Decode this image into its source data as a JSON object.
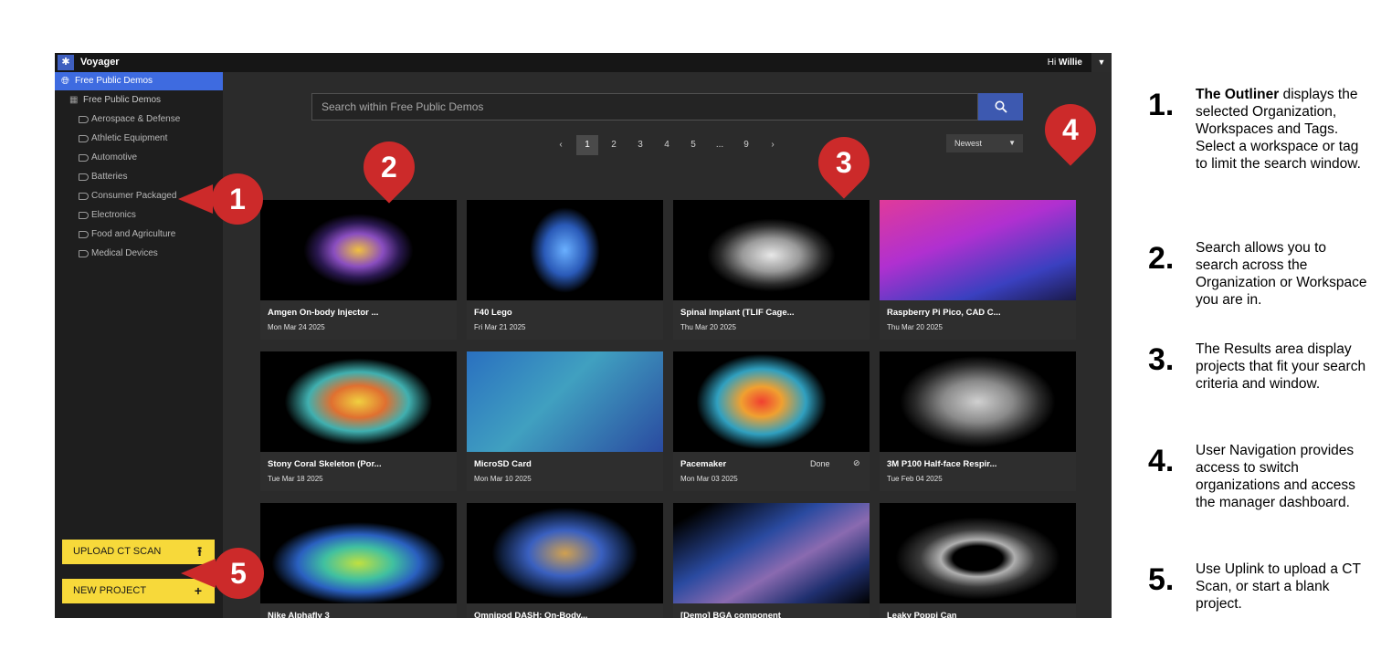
{
  "app": {
    "logo_glyph": "✱",
    "title": "Voyager",
    "greeting_prefix": "Hi",
    "user_name": "Willie"
  },
  "sidebar": {
    "organization": "Free Public Demos",
    "workspace": "Free Public Demos",
    "tags": [
      "Aerospace & Defense",
      "Athletic Equipment",
      "Automotive",
      "Batteries",
      "Consumer Packaged",
      "Electronics",
      "Food and Agriculture",
      "Medical Devices"
    ],
    "upload_label": "UPLOAD CT SCAN",
    "new_project_label": "NEW PROJECT"
  },
  "search": {
    "placeholder": "Search within Free Public Demos"
  },
  "pagination": {
    "prev": "‹",
    "pages": [
      "1",
      "2",
      "3",
      "4",
      "5",
      "...",
      "9"
    ],
    "next": "›",
    "current": "1"
  },
  "sort": {
    "selected": "Newest"
  },
  "results": [
    {
      "title": "Amgen On-body Injector ...",
      "date": "Mon Mar 24 2025"
    },
    {
      "title": "F40 Lego",
      "date": "Fri Mar 21 2025"
    },
    {
      "title": "Spinal Implant (TLIF Cage...",
      "date": "Thu Mar 20 2025"
    },
    {
      "title": "Raspberry Pi Pico, CAD C...",
      "date": "Thu Mar 20 2025"
    },
    {
      "title": "Stony Coral Skeleton (Por...",
      "date": "Tue Mar 18 2025"
    },
    {
      "title": "MicroSD Card",
      "date": "Mon Mar 10 2025"
    },
    {
      "title": "Pacemaker",
      "date": "Mon Mar 03 2025",
      "status": "Done"
    },
    {
      "title": "3M P100 Half-face Respir...",
      "date": "Tue Feb 04 2025"
    },
    {
      "title": "Nike Alphafly 3",
      "date": ""
    },
    {
      "title": "Omnipod DASH: On-Body...",
      "date": ""
    },
    {
      "title": "[Demo] BGA component",
      "date": ""
    },
    {
      "title": "Leaky Poppi Can",
      "date": ""
    }
  ],
  "callouts": [
    "1",
    "2",
    "3",
    "4",
    "5"
  ],
  "legend": [
    {
      "num": "1.",
      "bold": "The Outliner",
      "text": " displays the selected Organization, Workspaces and Tags. Select a workspace or tag to limit the search window."
    },
    {
      "num": "2.",
      "bold": "",
      "text": "Search allows you to search across the Organization or Workspace you are in."
    },
    {
      "num": "3.",
      "bold": "",
      "text": "The Results area display projects that fit your search criteria and window."
    },
    {
      "num": "4.",
      "bold": "",
      "text": "User Navigation provides access to switch organizations and access the manager dashboard."
    },
    {
      "num": "5.",
      "bold": "",
      "text": "Use Uplink to upload a CT Scan, or start a blank project."
    }
  ],
  "icons": {
    "globe": "globe-icon",
    "building": "building-icon",
    "tag": "tag-icon",
    "search": "search-icon",
    "upload": "upload-icon",
    "plus": "plus-icon",
    "caret": "chevron-down-icon",
    "check": "check-circle-icon"
  },
  "colors": {
    "accent_blue": "#3e6be0",
    "search_button": "#3d59b0",
    "yellow_button": "#f7d93a",
    "callout_red": "#cc2a2a"
  }
}
